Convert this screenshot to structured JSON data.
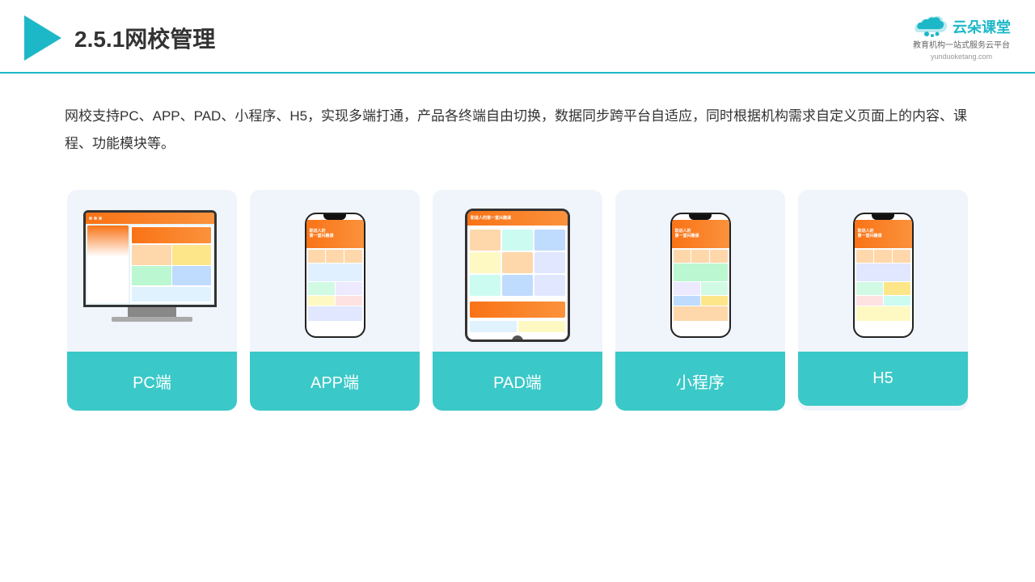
{
  "header": {
    "title": "2.5.1网校管理",
    "brand": {
      "name": "云朵课堂",
      "sub_line1": "教育机构一站",
      "sub_line2": "式服务云平台",
      "url": "yunduoketang.com"
    }
  },
  "description": {
    "text": "网校支持PC、APP、PAD、小程序、H5，实现多端打通，产品各终端自由切换，数据同步跨平台自适应，同时根据机构需求自定义页面上的内容、课程、功能模块等。"
  },
  "cards": [
    {
      "id": "pc",
      "label": "PC端"
    },
    {
      "id": "app",
      "label": "APP端"
    },
    {
      "id": "pad",
      "label": "PAD端"
    },
    {
      "id": "miniprogram",
      "label": "小程序"
    },
    {
      "id": "h5",
      "label": "H5"
    }
  ]
}
